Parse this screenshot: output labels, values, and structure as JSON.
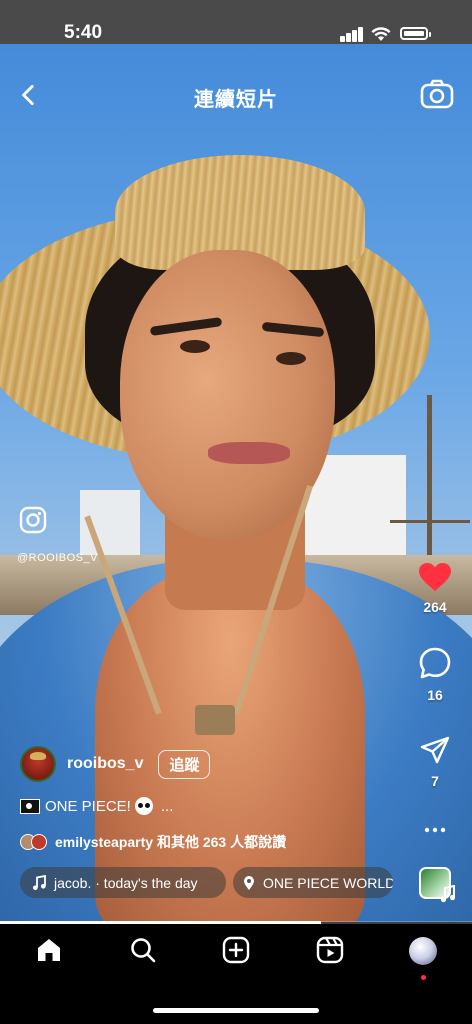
{
  "status_bar": {
    "time": "5:40"
  },
  "header": {
    "title": "連續短片"
  },
  "watermark": {
    "handle": "@ROOIBOS_V"
  },
  "actions": {
    "likes_count": "264",
    "comments_count": "16",
    "shares_count": "7"
  },
  "author": {
    "username": "rooibos_v",
    "follow_label": "追蹤"
  },
  "caption": {
    "text": "ONE PIECE!",
    "more": "..."
  },
  "liked_by": {
    "text": "emilysteaparty 和其他 263 人都說讚"
  },
  "music": {
    "label": "jacob. · today's the day"
  },
  "location": {
    "label": "ONE PIECE WORLD"
  },
  "playback": {
    "progress": 0.68
  },
  "colors": {
    "like_red": "#ff3040",
    "profile_dot": "#ff2d55"
  },
  "icons": {
    "back": "chevron-left-icon",
    "camera": "camera-icon",
    "like": "heart-icon",
    "comment": "comment-bubble-icon",
    "share": "paper-plane-icon",
    "more": "more-dots-icon",
    "music": "music-note-icon",
    "location": "location-pin-icon",
    "tab_home": "home-icon",
    "tab_search": "search-icon",
    "tab_create": "create-plus-icon",
    "tab_reels": "reels-icon",
    "tab_profile": "profile-avatar"
  }
}
